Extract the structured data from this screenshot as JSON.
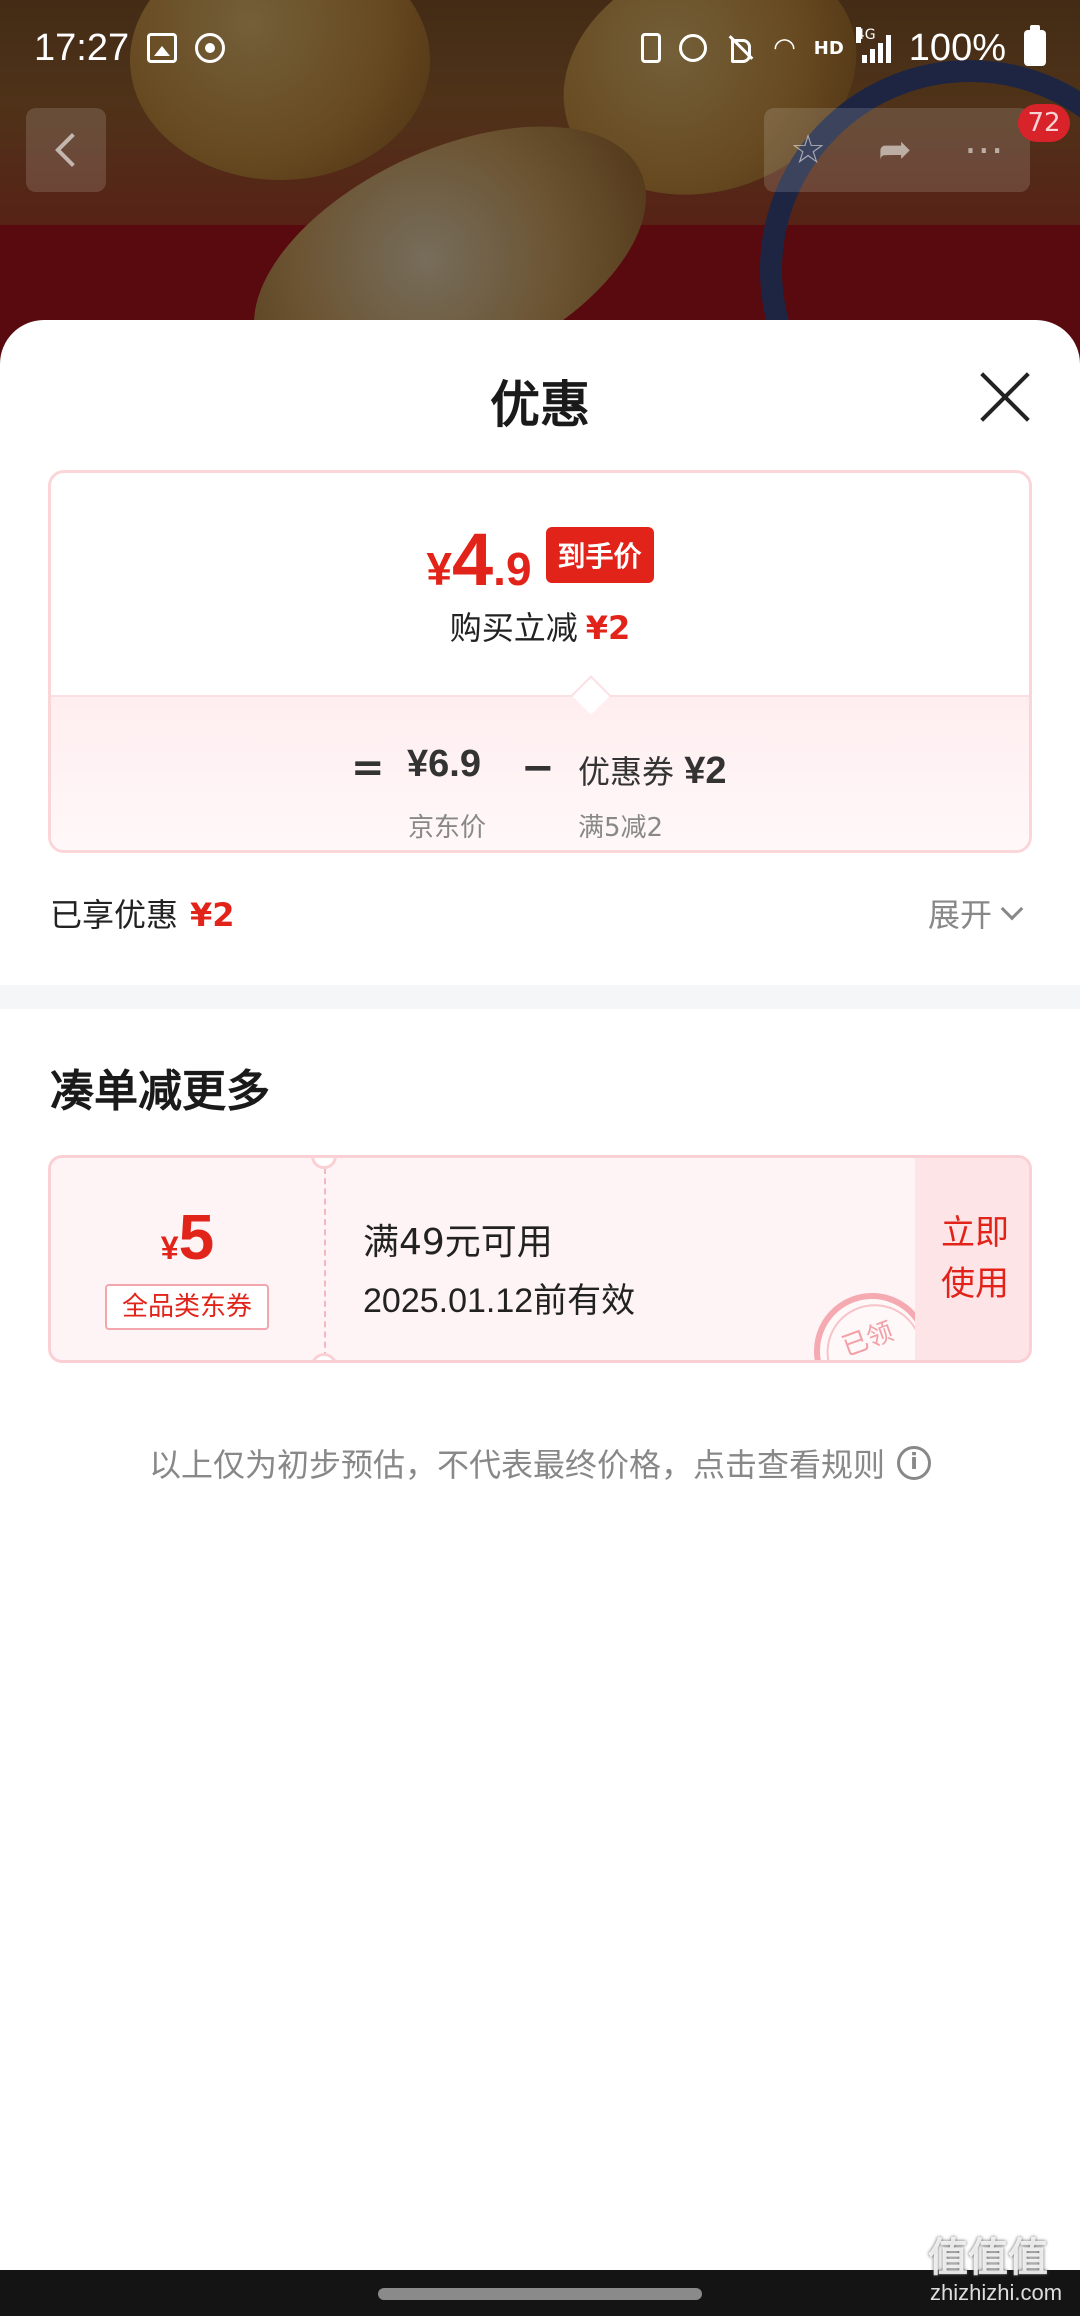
{
  "status": {
    "time": "17:27",
    "battery_pct": "100%",
    "network": "4G",
    "hd": "HD"
  },
  "nav": {
    "cart_count": "72"
  },
  "sheet": {
    "title": "优惠",
    "final_price": {
      "currency": "¥",
      "integer": "4",
      "decimal": ".9",
      "tag": "到手价"
    },
    "instant_discount": {
      "label": "购买立减",
      "amount": "¥2"
    },
    "formula": {
      "equals": "=",
      "base_price": "¥6.9",
      "base_label": "京东价",
      "minus": "−",
      "coupon_label": "优惠券",
      "coupon_amount": "¥2",
      "coupon_condition": "满5减2"
    },
    "enjoyed": {
      "label": "已享优惠",
      "amount": "¥2"
    },
    "expand_label": "展开"
  },
  "more": {
    "title": "凑单减更多",
    "coupon": {
      "currency": "¥",
      "amount": "5",
      "type": "全品类东券",
      "condition": "满49元可用",
      "valid_until": "2025.01.12前有效",
      "button_line1": "立即",
      "button_line2": "使用",
      "stamp": "已领"
    }
  },
  "disclaimer": "以上仅为初步预估，不代表最终价格，点击查看规则",
  "watermark": {
    "text": "值值值",
    "site": "zhizhizhi.com"
  }
}
